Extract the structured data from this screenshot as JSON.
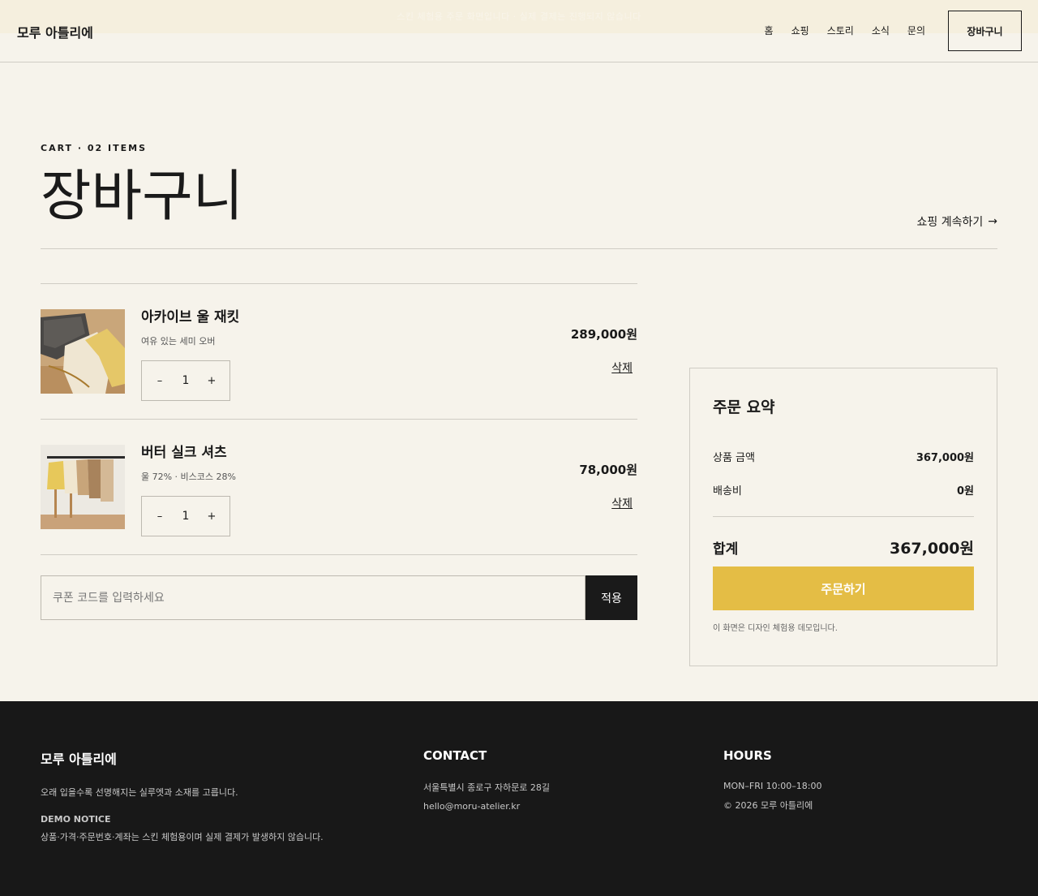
{
  "header": {
    "announcement": "스킨 체험용 주문 화면입니다 · 실제 결제는 진행되지 않습니다",
    "brand": "모루 아틀리에",
    "nav": [
      {
        "label": "홈"
      },
      {
        "label": "쇼핑"
      },
      {
        "label": "스토리"
      },
      {
        "label": "소식"
      },
      {
        "label": "문의"
      }
    ],
    "cart_label": "장바구니"
  },
  "hero": {
    "eyebrow": "CART · 02 ITEMS",
    "title": "장바구니",
    "continue_label": "쇼핑 계속하기",
    "continue_arrow": "→"
  },
  "cart": {
    "items": [
      {
        "name": "아카이브 울 재킷",
        "desc": "여유 있는 세미 오버",
        "qty": "1",
        "price": "289,000원",
        "remove": "삭제",
        "minus": "–",
        "plus": "+"
      },
      {
        "name": "버터 실크 셔츠",
        "desc": "울 72% · 비스코스 28%",
        "qty": "1",
        "price": "78,000원",
        "remove": "삭제",
        "minus": "–",
        "plus": "+"
      }
    ]
  },
  "coupon": {
    "placeholder": "쿠폰 코드를 입력하세요",
    "value": "",
    "apply_label": "적용"
  },
  "summary": {
    "title": "주문 요약",
    "subtotal_label": "상품 금액",
    "subtotal_value": "367,000원",
    "shipping_label": "배송비",
    "shipping_value": "0원",
    "total_label": "합계",
    "total_value": "367,000원",
    "order_label": "주문하기",
    "note": "이 화면은 디자인 체험용 데모입니다."
  },
  "footer": {
    "brand": "모루 아틀리에",
    "tagline": "오래 입을수록 선명해지는 실루엣과 소재를 고릅니다.",
    "notice_head": "DEMO NOTICE",
    "notice": "상품·가격·주문번호·계좌는 스킨 체험용이며 실제 결제가 발생하지 않습니다.",
    "contact_head": "CONTACT",
    "address": "서울특별시 종로구 자하문로 28길",
    "email": "hello@moru-atelier.kr",
    "hours_head": "HOURS",
    "hours": "MON–FRI 10:00–18:00",
    "copyright": "© 2026 모루 아틀리에"
  },
  "colors": {
    "background": "#f6f3eb",
    "accent": "#e4bd45",
    "dark": "#181818"
  }
}
